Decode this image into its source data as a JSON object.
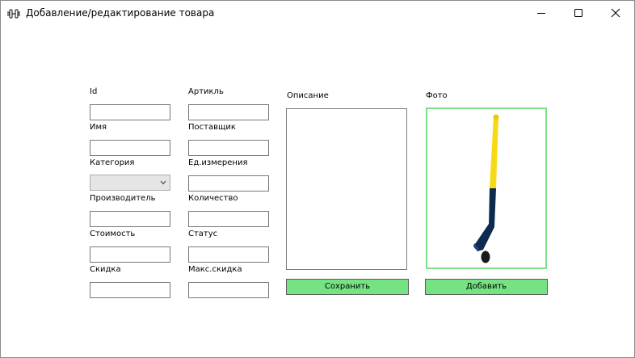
{
  "window": {
    "title": "Добавление/редактирование товара",
    "icon": "barbell-icon"
  },
  "form": {
    "id_label": "Id",
    "article_label": "Артикль",
    "name_label": "Имя",
    "supplier_label": "Поставщик",
    "category_label": "Категория",
    "unit_label": "Ед.измерения",
    "manufacturer_label": "Производитель",
    "quantity_label": "Количество",
    "cost_label": "Стоимость",
    "status_label": "Статус",
    "discount_label": "Скидка",
    "max_discount_label": "Макс.скидка",
    "description_label": "Описание",
    "photo_label": "Фото",
    "category_value": "",
    "values": {
      "id": "",
      "article": "",
      "name": "",
      "supplier": "",
      "unit": "",
      "manufacturer": "",
      "quantity": "",
      "cost": "",
      "status": "",
      "discount": "",
      "max_discount": "",
      "description": ""
    }
  },
  "buttons": {
    "save_label": "Сохранить",
    "add_label": "Добавить"
  },
  "photo": {
    "subject": "hockey-stick-icon"
  },
  "colors": {
    "button_bg": "#76e383",
    "photo_border": "#7fe08a",
    "stick_handle": "#f7d914",
    "stick_blade": "#0d2a4f"
  }
}
